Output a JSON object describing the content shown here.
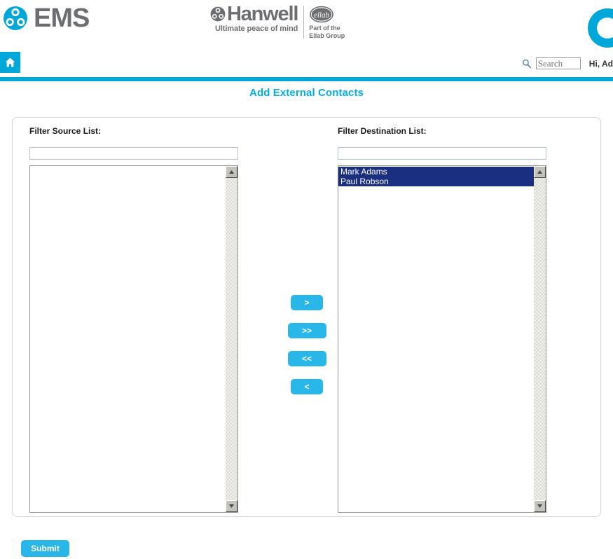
{
  "header": {
    "ems_wordmark": "EMS",
    "ems_logo_icon": "ems-circular-logo-icon",
    "hanwell_wordmark": "Hanwell",
    "hanwell_tagline": "Ultimate peace of mind",
    "hanwell_logo_icon": "hanwell-circular-logo-icon",
    "ellab_wordmark": "ellab",
    "ellab_caption_line1": "Part of the",
    "ellab_caption_line2": "Ellab Group",
    "corner_icon": "cyan-circle-decoration-icon"
  },
  "nav": {
    "home_icon": "home-icon",
    "search_icon": "search-magnifier-icon",
    "search_placeholder": "Search",
    "search_value": "",
    "greeting": "Hi, Ad"
  },
  "page": {
    "title": "Add External Contacts"
  },
  "source": {
    "label": "Filter Source List:",
    "filter_value": "",
    "filter_placeholder": "",
    "items": [],
    "scroll_up_icon": "scroll-up-arrow-icon",
    "scroll_down_icon": "scroll-down-arrow-icon"
  },
  "destination": {
    "label": "Filter Destination List:",
    "filter_value": "",
    "filter_placeholder": "",
    "items": [
      {
        "label": "Mark Adams",
        "selected": true
      },
      {
        "label": "Paul Robson",
        "selected": true
      }
    ],
    "scroll_up_icon": "scroll-up-arrow-icon",
    "scroll_down_icon": "scroll-down-arrow-icon"
  },
  "transfer": {
    "move_right": ">",
    "move_all_right": ">>",
    "move_all_left": "<<",
    "move_left": "<"
  },
  "footer": {
    "submit_label": "Submit"
  },
  "colors": {
    "accent": "#00a7d9",
    "button": "#29b6e8",
    "title": "#00b0e6",
    "selection": "#1b2f80",
    "logo_gray": "#6d6e71"
  }
}
